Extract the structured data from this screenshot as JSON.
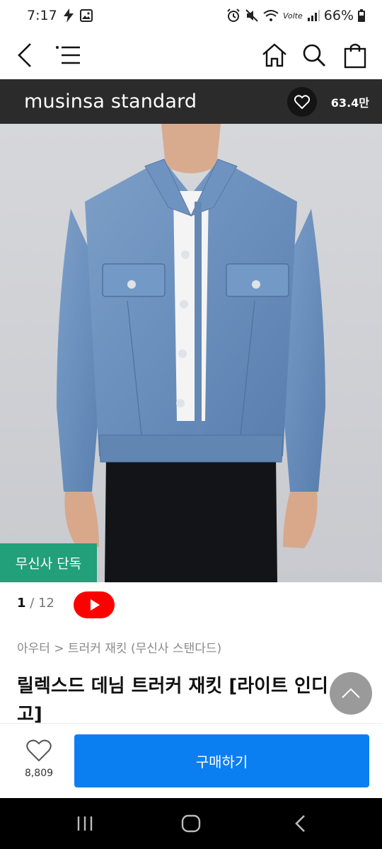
{
  "status_bar": {
    "time": "7:17",
    "battery": "66%",
    "network": "Volte"
  },
  "app_nav": {
    "icons": [
      "back-icon",
      "menu-icon",
      "home-icon",
      "search-icon",
      "cart-icon"
    ]
  },
  "brand": {
    "name": "musinsa standard",
    "like_count": "63.4만"
  },
  "product": {
    "exclusive_badge": "무신사 단독",
    "image_index": "1",
    "image_total": "12",
    "breadcrumb": "아우터 > 트러커 재킷 (무신사 스탠다드)",
    "title": "릴렉스드 데님 트러커 재킷 [라이트 인디고]"
  },
  "purchase": {
    "wish_count": "8,809",
    "buy_label": "구매하기"
  },
  "colors": {
    "brand_bar": "#2b2b2b",
    "exclusive_badge": "#21a07a",
    "buy_button": "#0a7ff2",
    "youtube": "#ff0000"
  }
}
